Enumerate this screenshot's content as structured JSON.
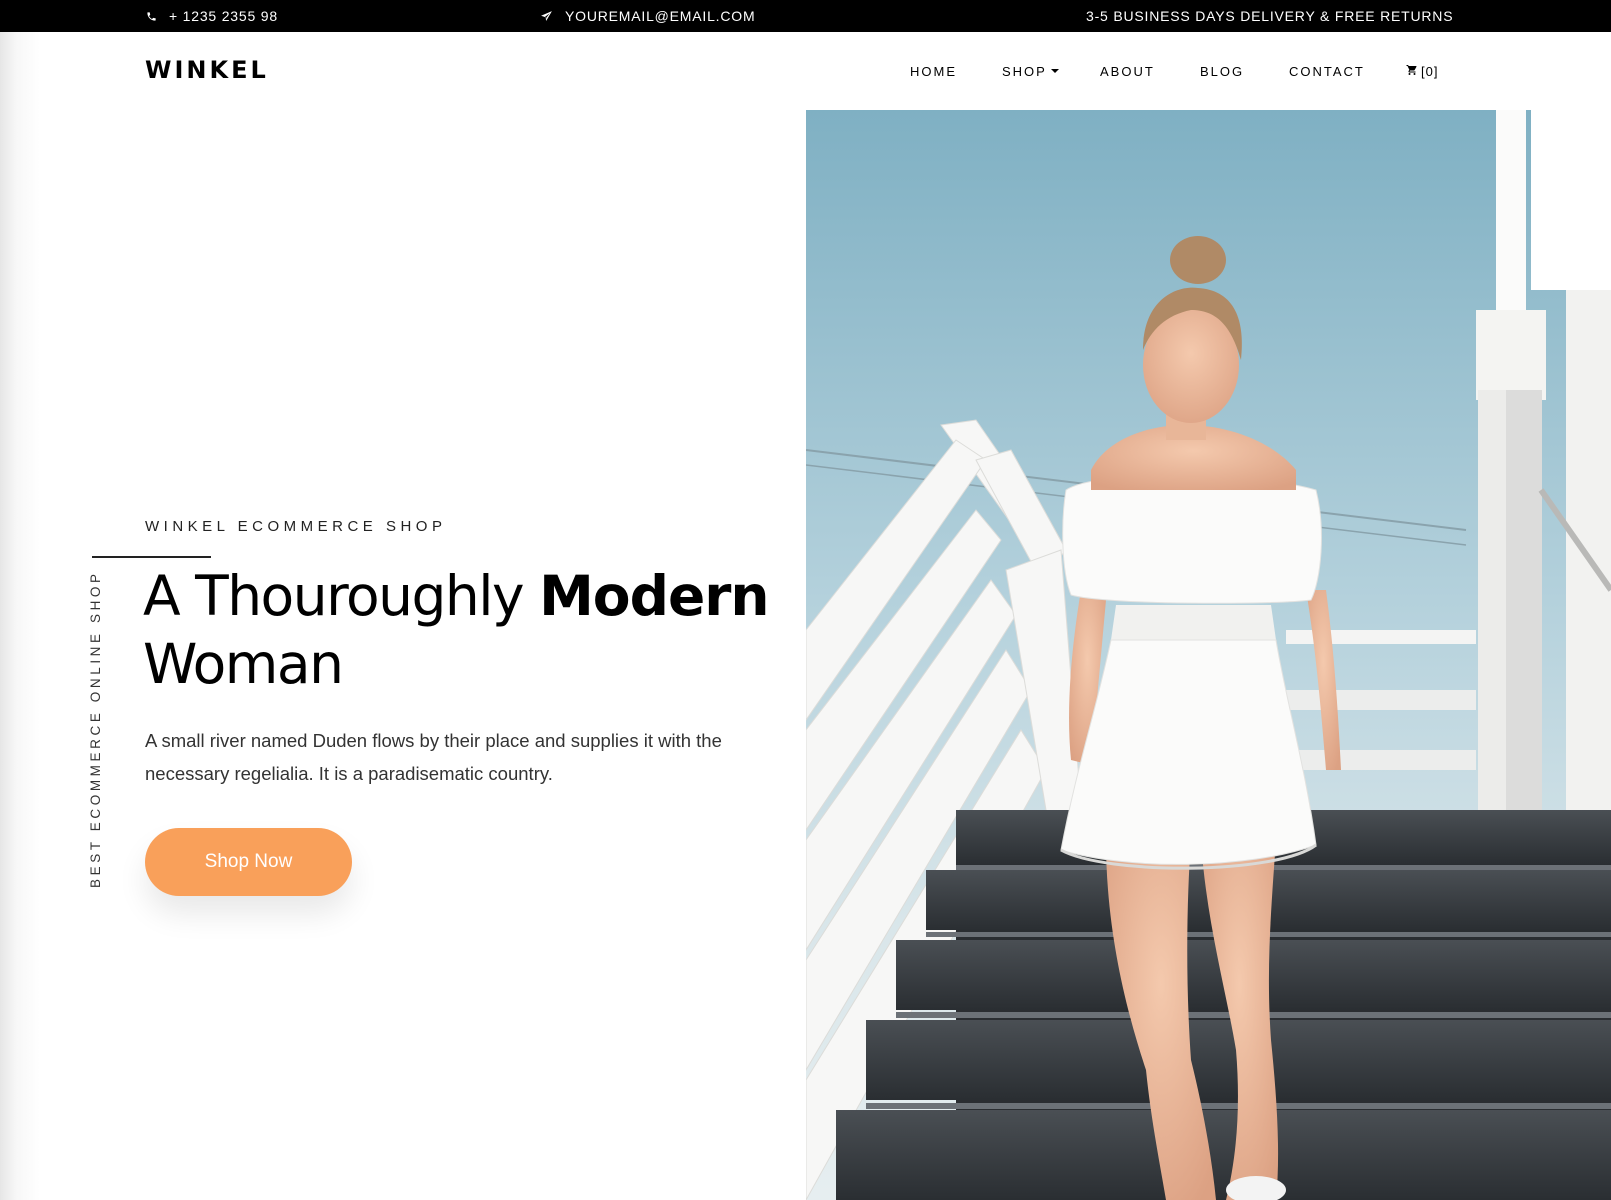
{
  "topbar": {
    "phone": "+ 1235 2355 98",
    "email": "YOUREMAIL@EMAIL.COM",
    "delivery": "3-5 BUSINESS DAYS DELIVERY & FREE RETURNS",
    "phone_icon": "phone-icon",
    "email_icon": "paper-plane-icon"
  },
  "nav": {
    "logo": "WINKEL",
    "items": [
      {
        "label": "HOME"
      },
      {
        "label": "SHOP"
      },
      {
        "label": "ABOUT"
      },
      {
        "label": "BLOG"
      },
      {
        "label": "CONTACT"
      }
    ],
    "cart_label": "[0]",
    "cart_icon": "cart-icon"
  },
  "hero": {
    "subtitle": "WINKEL ECOMMERCE SHOP",
    "vertical_text": "BEST ECOMMERCE ONLINE SHOP",
    "headline_light": "A Thouroughly ",
    "headline_bold": "Modern",
    "headline_line2": "Woman",
    "description": "A small river named Duden flows by their place and supplies it with the necessary regelialia. It is a paradisematic country.",
    "button_label": "Shop Now"
  },
  "colors": {
    "accent": "#f9a05a",
    "topbar_bg": "#000000",
    "text": "#000000"
  }
}
